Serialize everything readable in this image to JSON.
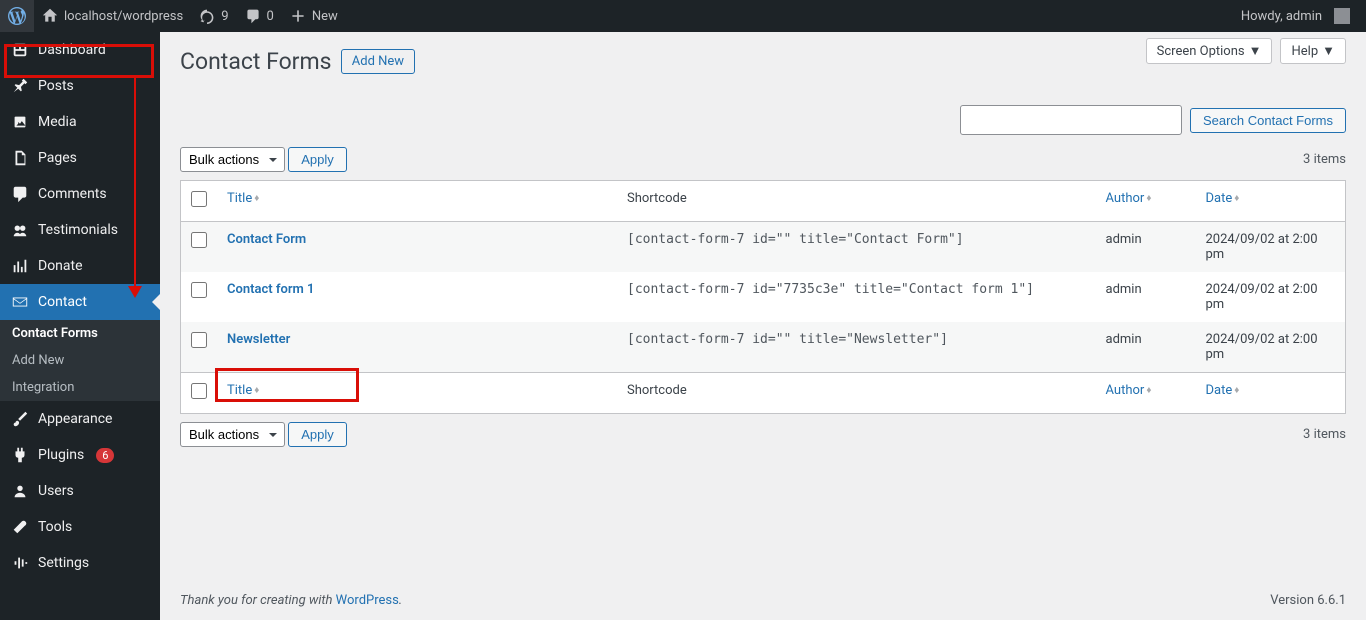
{
  "adminbar": {
    "site_name": "localhost/wordpress",
    "updates": "9",
    "comments": "0",
    "new": "New",
    "howdy": "Howdy, admin"
  },
  "sidebar": {
    "dashboard": "Dashboard",
    "posts": "Posts",
    "media": "Media",
    "pages": "Pages",
    "comments": "Comments",
    "testimonials": "Testimonials",
    "donate": "Donate",
    "contact": "Contact",
    "contact_sub": {
      "forms": "Contact Forms",
      "add": "Add New",
      "integration": "Integration"
    },
    "appearance": "Appearance",
    "plugins": "Plugins",
    "plugins_count": "6",
    "users": "Users",
    "tools": "Tools",
    "settings": "Settings"
  },
  "screen": {
    "options": "Screen Options",
    "help": "Help"
  },
  "page": {
    "title": "Contact Forms",
    "add_new": "Add New",
    "search_btn": "Search Contact Forms",
    "bulk_label": "Bulk actions",
    "apply": "Apply",
    "items_count": "3 items"
  },
  "columns": {
    "title": "Title",
    "shortcode": "Shortcode",
    "author": "Author",
    "date": "Date"
  },
  "rows": [
    {
      "title": "Contact Form",
      "shortcode": "[contact-form-7 id=\"\" title=\"Contact Form\"]",
      "author": "admin",
      "date": "2024/09/02 at 2:00 pm"
    },
    {
      "title": "Contact form 1",
      "shortcode": "[contact-form-7 id=\"7735c3e\" title=\"Contact form 1\"]",
      "author": "admin",
      "date": "2024/09/02 at 2:00 pm"
    },
    {
      "title": "Newsletter",
      "shortcode": "[contact-form-7 id=\"\" title=\"Newsletter\"]",
      "author": "admin",
      "date": "2024/09/02 at 2:00 pm"
    }
  ],
  "footer": {
    "thanks": "Thank you for creating with ",
    "wp": "WordPress",
    "period": ".",
    "version": "Version 6.6.1"
  }
}
